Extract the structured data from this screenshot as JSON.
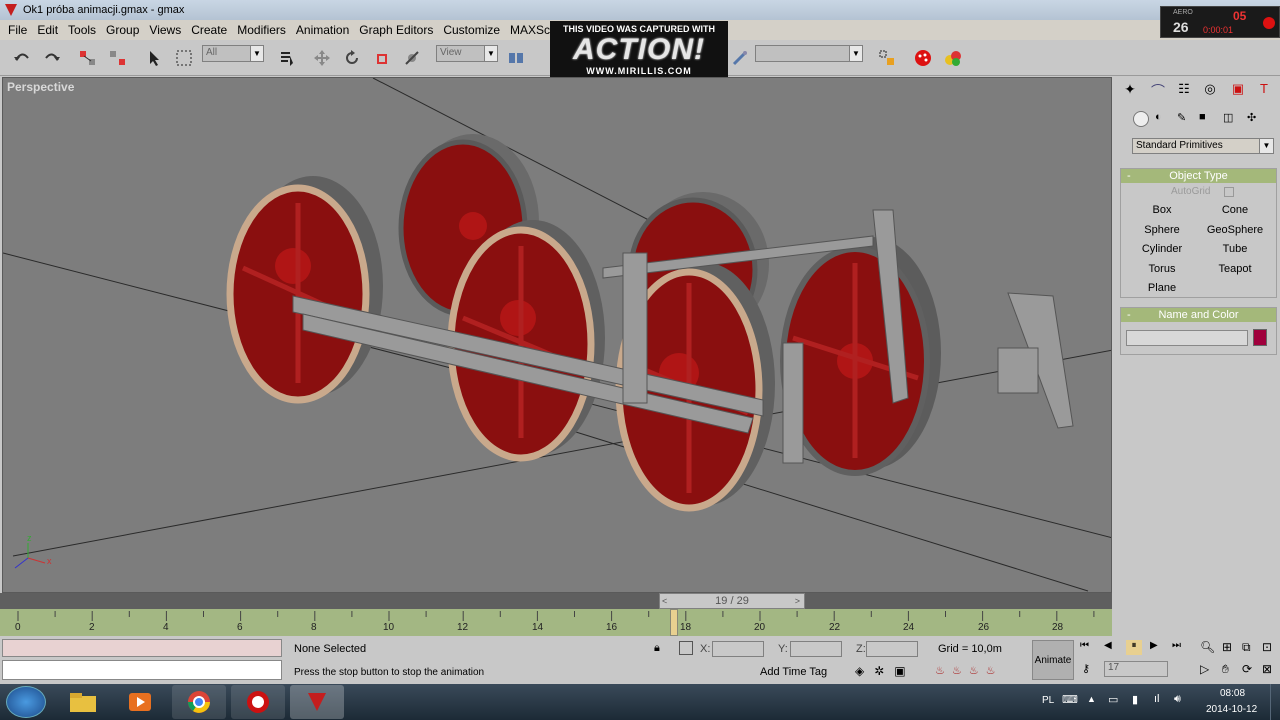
{
  "window": {
    "title": "Ok1 próba animacji.gmax - gmax"
  },
  "menu": [
    "File",
    "Edit",
    "Tools",
    "Group",
    "Views",
    "Create",
    "Modifiers",
    "Animation",
    "Graph Editors",
    "Customize",
    "MAXSc"
  ],
  "toolbar": {
    "selection_filter": "All",
    "ref_coord": "View"
  },
  "overlay": {
    "caption": "THIS VIDEO WAS CAPTURED WITH",
    "logo": "ACTION!",
    "site": "WWW.MIRILLIS.COM"
  },
  "viewport": {
    "label": "Perspective"
  },
  "command_panel": {
    "category": "Standard Primitives",
    "object_type": {
      "title": "Object Type",
      "autogrid_label": "AutoGrid",
      "buttons": [
        "Box",
        "Cone",
        "Sphere",
        "GeoSphere",
        "Cylinder",
        "Tube",
        "Torus",
        "Teapot",
        "Plane"
      ]
    },
    "name_color": {
      "title": "Name and Color",
      "color": "#a0003c"
    }
  },
  "time_slider": {
    "label": "19 / 29"
  },
  "track_ticks": [
    "0",
    "2",
    "4",
    "6",
    "8",
    "10",
    "12",
    "14",
    "16",
    "18",
    "20",
    "22",
    "24",
    "26",
    "28"
  ],
  "status": {
    "selection": "None Selected",
    "prompt": "Press the stop button to stop the animation",
    "coord_x": "X:",
    "coord_y": "Y:",
    "coord_z": "Z:",
    "grid": "Grid = 10,0m",
    "add_time_tag": "Add Time Tag",
    "animate": "Animate",
    "frame": "17"
  },
  "tray": {
    "lang": "PL",
    "time": "08:08",
    "date": "2014-10-12"
  },
  "recorder": {
    "top": "AERO",
    "fps": "26",
    "rec": "05",
    "timer": "0:00:01"
  },
  "colors": {
    "wheel_red": "#8a0f0f",
    "rim": "#c9a98c",
    "viewport_bg": "#7d7d7d",
    "trackbar": "#a3b783",
    "rollout_head": "#a4b87a"
  }
}
